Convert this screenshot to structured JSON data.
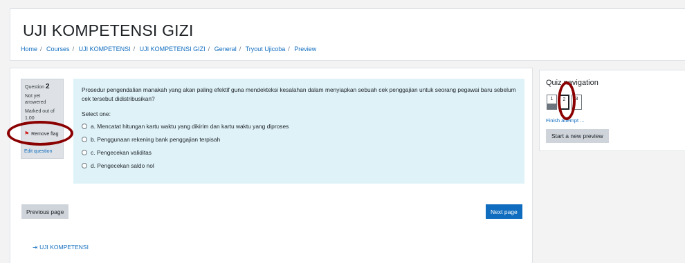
{
  "header": {
    "title": "UJI KOMPETENSI GIZI",
    "breadcrumb": [
      "Home",
      "Courses",
      "UJI KOMPETENSI",
      "UJI KOMPETENSI GIZI",
      "General",
      "Tryout Ujicoba",
      "Preview"
    ]
  },
  "question_info": {
    "question_label": "Question",
    "question_number": "2",
    "state": "Not yet answered",
    "grade": "Marked out of 1.00",
    "flag_label": "Remove flag",
    "edit_label": "Edit question"
  },
  "question": {
    "text": "Prosedur pengendalian manakah yang akan paling efektif guna mendekteksi kesalahan dalam menyiapkan sebuah cek penggajian untuk seorang pegawai baru sebelum cek tersebut didistribusikan?",
    "prompt": "Select one:",
    "answers": [
      "a. Mencatat hitungan kartu waktu yang dikirim dan kartu waktu yang diproses",
      "b. Penggunaan rekening bank penggajian terpisah",
      "c. Pengecekan validitas",
      "d. Pengecekan saldo nol"
    ]
  },
  "footer": {
    "previous_label": "Previous page",
    "next_label": "Next page",
    "back_link": "UJI KOMPETENSI"
  },
  "quiz_nav": {
    "title": "Quiz navigation",
    "buttons": [
      "1",
      "2",
      "3"
    ],
    "finish_label": "Finish attempt ...",
    "new_preview_label": "Start a new preview"
  },
  "colors": {
    "accent": "#0f6cbf",
    "question_bg": "#def2f8",
    "annotation": "#8b0000"
  }
}
